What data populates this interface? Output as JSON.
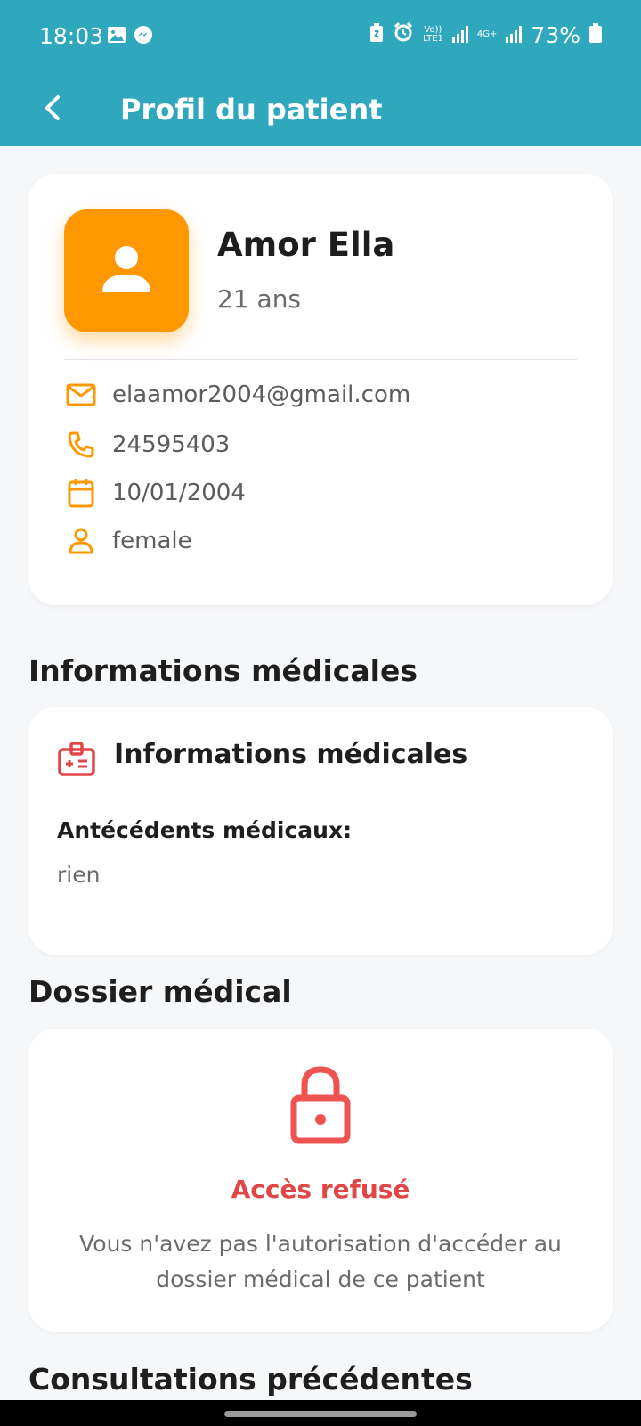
{
  "status_bar": {
    "time": "18:03",
    "battery": "73%",
    "net1_top": "Vo))",
    "net1_bottom": "LTE1",
    "net2": "4G+"
  },
  "app_bar": {
    "title": "Profil du patient"
  },
  "patient": {
    "name": "Amor Ella",
    "age": "21 ans",
    "email": "elaamor2004@gmail.com",
    "phone": "24595403",
    "birthdate": "10/01/2004",
    "gender": "female"
  },
  "sections": {
    "medical_info_title": "Informations médicales",
    "medical_record_title": "Dossier médical",
    "previous_consultations_title": "Consultations précédentes"
  },
  "medical_info_card": {
    "header": "Informations médicales",
    "history_label": "Antécédents médicaux:",
    "history_value": "rien"
  },
  "medical_record_card": {
    "denied_title": "Accès refusé",
    "denied_message": "Vous n'avez pas l'autorisation d'accéder au dossier médical de ce patient"
  },
  "colors": {
    "primary": "#2fa8bd",
    "accent": "#ff9800",
    "danger": "#e04646"
  },
  "icons": [
    "image-icon",
    "messenger-icon",
    "battery-saver-icon",
    "alarm-icon",
    "signal-icon",
    "battery-icon",
    "back-arrow-icon",
    "person-icon",
    "mail-icon",
    "phone-icon",
    "calendar-icon",
    "gender-icon",
    "medical-id-icon",
    "lock-icon"
  ]
}
